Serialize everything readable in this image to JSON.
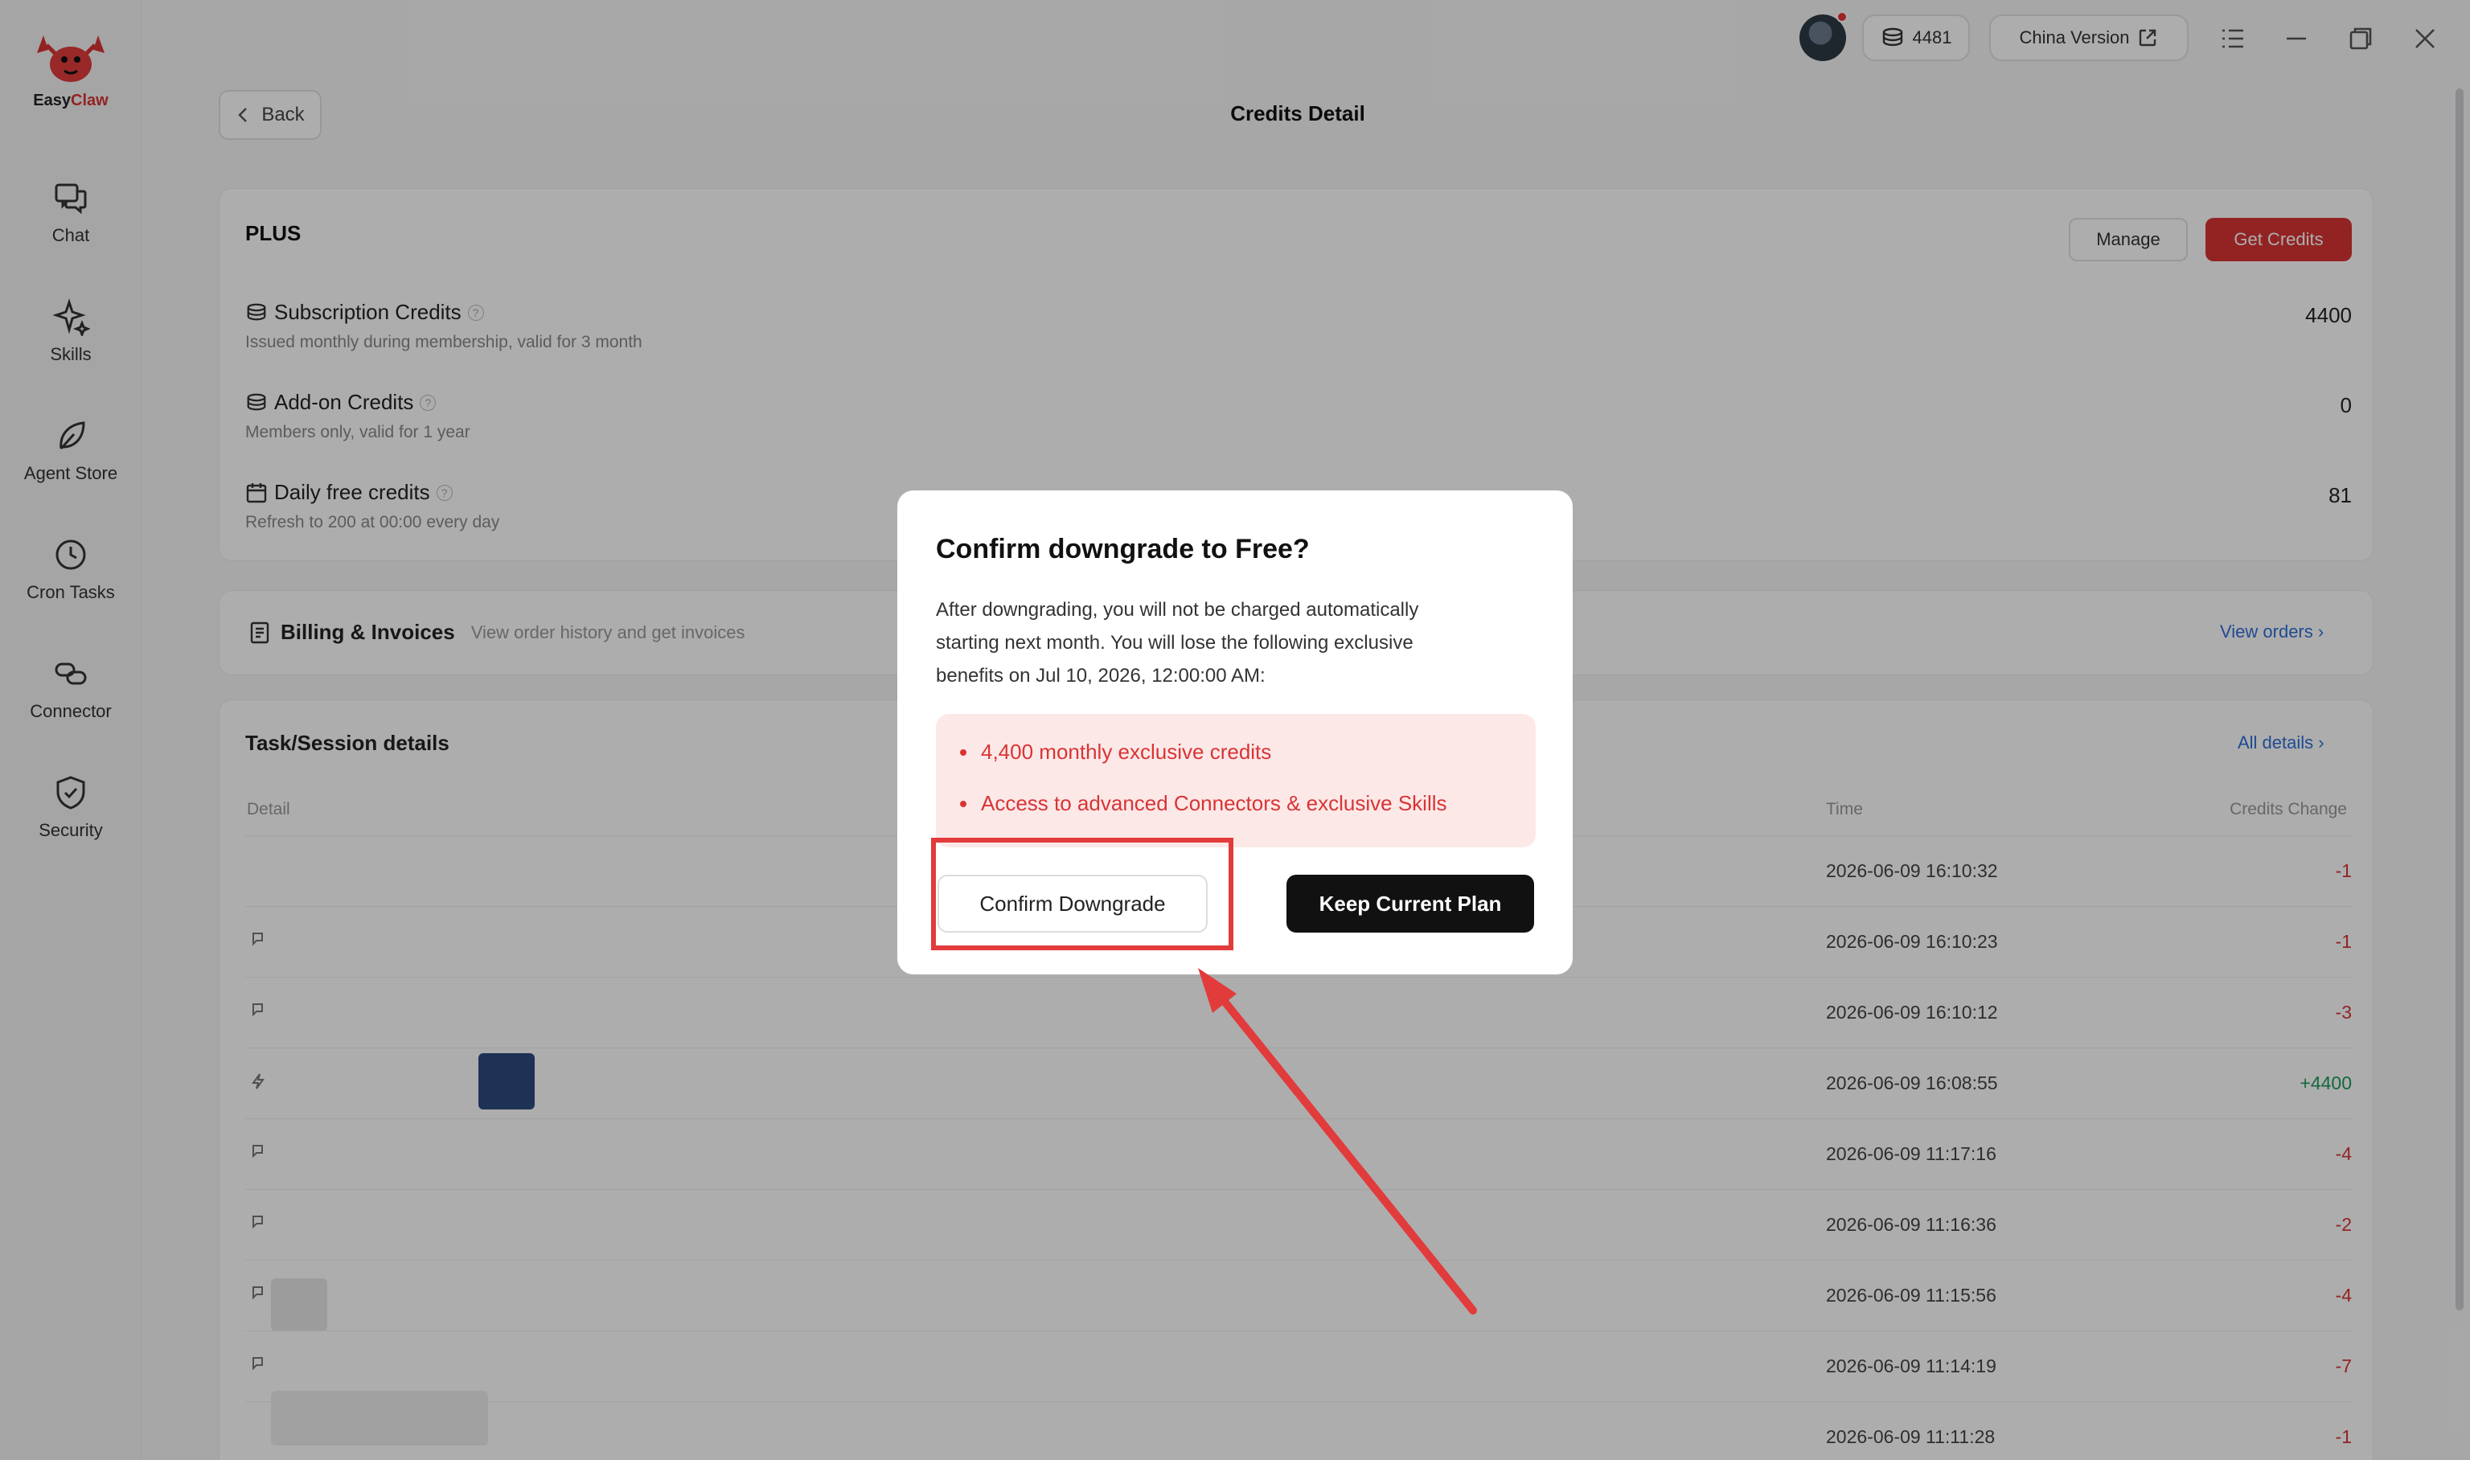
{
  "sidebar": {
    "logo": {
      "easy": "Easy",
      "claw": "Claw"
    },
    "items": [
      {
        "label": "Chat",
        "icon": "chat-icon"
      },
      {
        "label": "Skills",
        "icon": "sparkle-icon"
      },
      {
        "label": "Agent Store",
        "icon": "leaf-icon"
      },
      {
        "label": "Cron Tasks",
        "icon": "clock-icon"
      },
      {
        "label": "Connector",
        "icon": "link-icon"
      },
      {
        "label": "Security",
        "icon": "shield-icon"
      }
    ]
  },
  "topbar": {
    "credits": "4481",
    "version_label": "China Version"
  },
  "header": {
    "back_label": "Back",
    "title": "Credits Detail"
  },
  "plan": {
    "name": "PLUS",
    "manage_label": "Manage",
    "get_credits_label": "Get Credits",
    "rows": [
      {
        "title": "Subscription Credits",
        "desc": "Issued monthly during membership, valid for 3 month",
        "value": "4400"
      },
      {
        "title": "Add-on Credits",
        "desc": "Members only, valid for 1 year",
        "value": "0"
      },
      {
        "title": "Daily free credits",
        "desc": "Refresh to 200 at 00:00 every day",
        "value": "81"
      }
    ]
  },
  "billing": {
    "title": "Billing & Invoices",
    "desc": "View order history and get invoices",
    "link": "View orders"
  },
  "tasks": {
    "title": "Task/Session details",
    "link": "All details",
    "columns": {
      "detail": "Detail",
      "time": "Time",
      "change": "Credits Change"
    },
    "rows": [
      {
        "time": "2026-06-09 16:10:32",
        "change": "-1"
      },
      {
        "time": "2026-06-09 16:10:23",
        "change": "-1"
      },
      {
        "time": "2026-06-09 16:10:12",
        "change": "-3"
      },
      {
        "time": "2026-06-09 16:08:55",
        "change": "+4400"
      },
      {
        "time": "2026-06-09 11:17:16",
        "change": "-4"
      },
      {
        "time": "2026-06-09 11:16:36",
        "change": "-2"
      },
      {
        "time": "2026-06-09 11:15:56",
        "change": "-4"
      },
      {
        "time": "2026-06-09 11:14:19",
        "change": "-7"
      },
      {
        "time": "2026-06-09 11:11:28",
        "change": "-1"
      }
    ]
  },
  "modal": {
    "title": "Confirm downgrade to Free?",
    "body_lines": [
      "After downgrading, you will not be charged automatically",
      "starting next month. You will lose the following exclusive",
      "benefits on Jul 10, 2026, 12:00:00 AM:"
    ],
    "benefits": [
      "4,400 monthly exclusive credits",
      "Access to advanced Connectors & exclusive Skills"
    ],
    "confirm_label": "Confirm Downgrade",
    "keep_label": "Keep Current Plan"
  },
  "colors": {
    "accent": "#d93434",
    "positive": "#1e9a5a",
    "link": "#2f6fd8",
    "annotation": "#e23b3b"
  }
}
